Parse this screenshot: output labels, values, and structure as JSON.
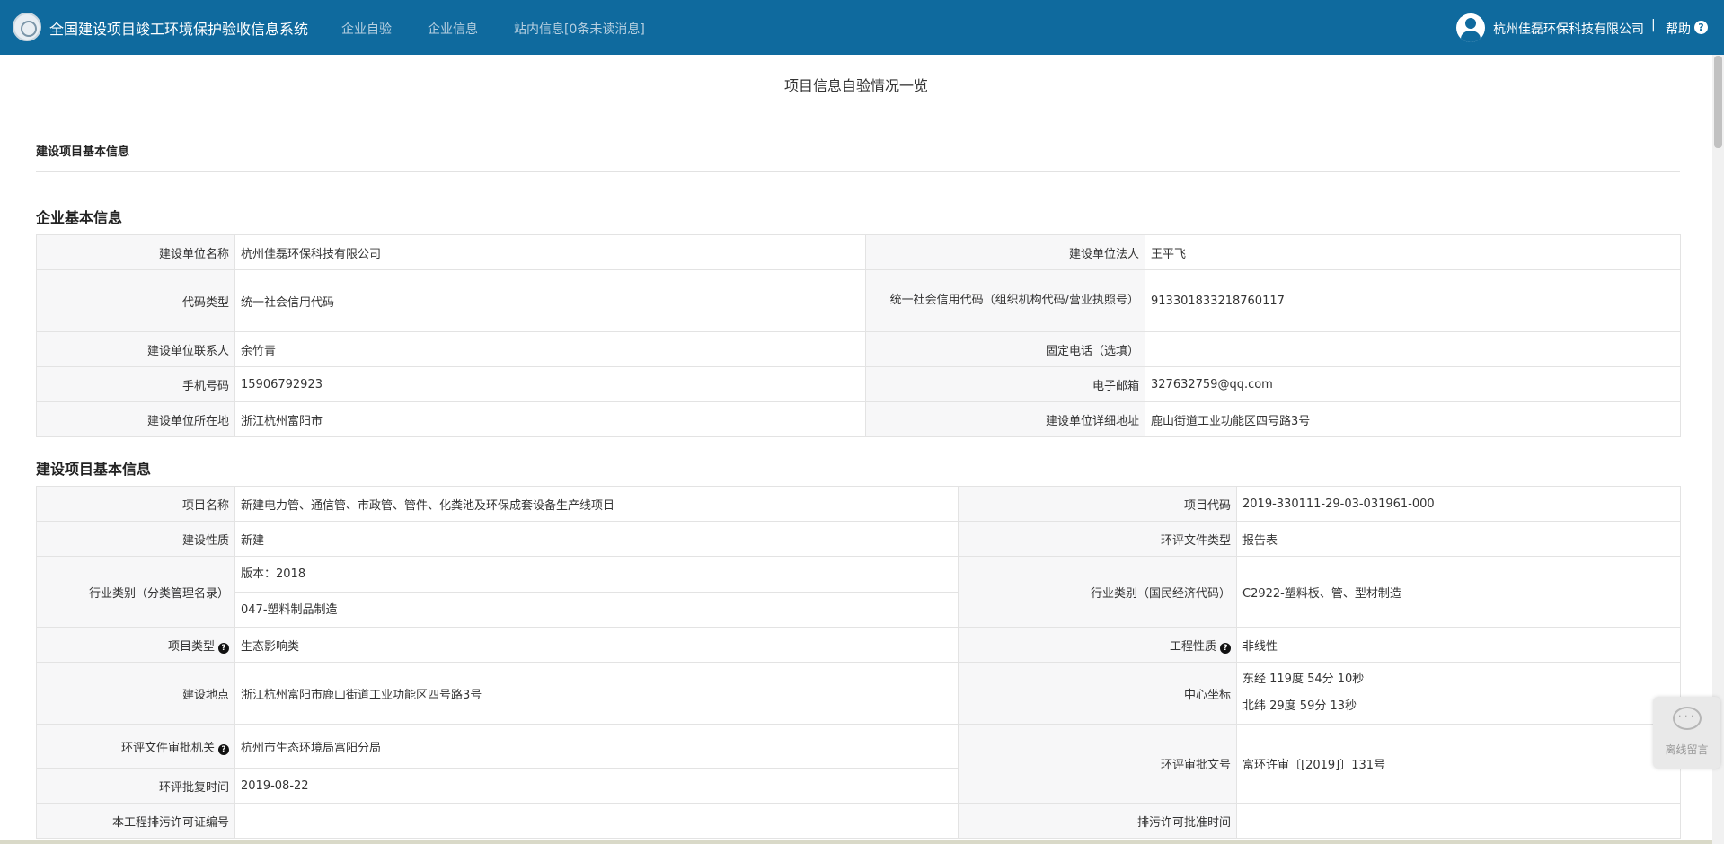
{
  "header": {
    "system_title": "全国建设项目竣工环境保护验收信息系统",
    "nav": [
      "企业自验",
      "企业信息",
      "站内信息[0条未读消息]"
    ],
    "user_name": "杭州佳磊环保科技有限公司",
    "separator": "|",
    "help_label": "帮助",
    "help_icon_glyph": "?"
  },
  "page": {
    "title": "项目信息自验情况一览",
    "tab_title": "建设项目基本信息"
  },
  "company_section": {
    "title": "企业基本信息",
    "rows": [
      {
        "l1": "建设单位名称",
        "v1": "杭州佳磊环保科技有限公司",
        "l2": "建设单位法人",
        "v2": "王平飞"
      },
      {
        "l1": "代码类型",
        "v1": "统一社会信用代码",
        "l2": "统一社会信用代码（组织机构代码/营业执照号）",
        "v2": "913301833218760117"
      },
      {
        "l1": "建设单位联系人",
        "v1": "余竹青",
        "l2": "固定电话（选填）",
        "v2": ""
      },
      {
        "l1": "手机号码",
        "v1": "15906792923",
        "l2": "电子邮箱",
        "v2": "327632759@qq.com"
      },
      {
        "l1": "建设单位所在地",
        "v1": "浙江杭州富阳市",
        "l2": "建设单位详细地址",
        "v2": "鹿山街道工业功能区四号路3号"
      }
    ]
  },
  "project_section": {
    "title": "建设项目基本信息",
    "project_name_label": "项目名称",
    "project_name": "新建电力管、通信管、市政管、管件、化粪池及环保成套设备生产线项目",
    "project_code_label": "项目代码",
    "project_code": "2019-330111-29-03-031961-000",
    "nature_label": "建设性质",
    "nature": "新建",
    "eia_type_label": "环评文件类型",
    "eia_type": "报告表",
    "industry_label": "行业类别（分类管理名录）",
    "industry_version": "版本：2018",
    "industry_value": "047-塑料制品制造",
    "industry_nat_label": "行业类别（国民经济代码）",
    "industry_nat": "C2922-塑料板、管、型材制造",
    "proj_type_label": "项目类型",
    "proj_type": "生态影响类",
    "eng_nature_label": "工程性质",
    "eng_nature": "非线性",
    "location_label": "建设地点",
    "location": "浙江杭州富阳市鹿山街道工业功能区四号路3号",
    "coord_label": "中心坐标",
    "coord_east": "东经 119度 54分 10秒",
    "coord_north": "北纬 29度 59分 13秒",
    "approval_org_label": "环评文件审批机关",
    "approval_org": "杭州市生态环境局富阳分局",
    "approval_no_label": "环评审批文号",
    "approval_no": "富环许审〔[2019]〕131号",
    "approval_date_label": "环评批复时间",
    "approval_date": "2019-08-22",
    "permit_no_label": "本工程排污许可证编号",
    "permit_no": "",
    "permit_date_label": "排污许可批准时间",
    "permit_date": "",
    "help_icon_glyph": "?"
  },
  "widget": {
    "label": "离线留言"
  }
}
